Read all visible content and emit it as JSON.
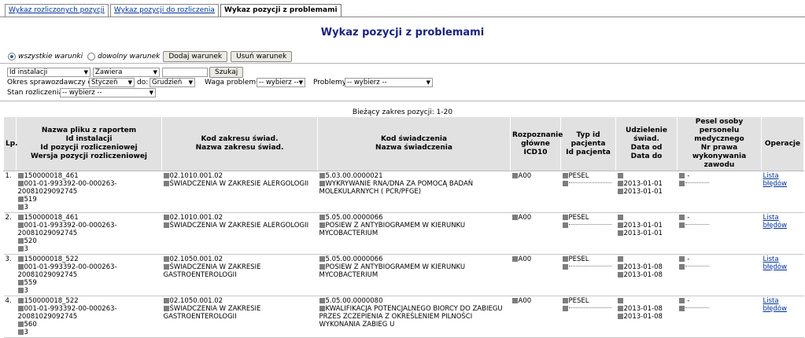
{
  "tabs": [
    "Wykaz rozliczonych pozycji",
    "Wykaz pozycji do rozliczenia",
    "Wykaz pozycji z problemami"
  ],
  "page_title": "Wykaz pozycji z problemami",
  "conditions": {
    "all_label": "wszystkie warunki",
    "any_label": "dowolny warunek",
    "add_button": "Dodaj warunek",
    "remove_button": "Usuń warunek"
  },
  "filter": {
    "field": "Id instalacji",
    "operator": "Zawiera",
    "value": "",
    "search_button": "Szukaj",
    "period_label": "Okres sprawozdawczy od:",
    "from": "Styczeń",
    "to_label": "do:",
    "to": "Grudzień",
    "weight_label": "Waga problemu:",
    "weight": "-- wybierz --",
    "problems_label": "Problemy:",
    "problems": "-- wybierz --",
    "status_label": "Stan rozliczenia:",
    "status": "-- wybierz --"
  },
  "range_text": "Bieżący zakres pozycji: 1-20",
  "headers": {
    "lp": "Lp.",
    "file": [
      "Nazwa pliku z raportem",
      "Id instalacji",
      "Id pozycji rozliczeniowej",
      "Wersja pozycji rozliczeniowej"
    ],
    "range": [
      "Kod zakresu świad.",
      "Nazwa zakresu świad."
    ],
    "service": [
      "Kod świadczenia",
      "Nazwa świadczenia"
    ],
    "icd": [
      "Rozpoznanie",
      "główne ICD10"
    ],
    "patient": [
      "Typ id pacjenta",
      "Id pacjenta"
    ],
    "dates": [
      "Udzielenie świad.",
      "Data od",
      "Data do"
    ],
    "staff": [
      "Pesel osoby",
      "personelu medycznego",
      "Nr prawa",
      "wykonywania zawodu"
    ],
    "ops": "Operacje"
  },
  "rows": [
    {
      "lp": "1.",
      "file": "150000018_461",
      "inst": "001-01-993392-00-000263-20081029092745",
      "pos": "519",
      "ver": "3",
      "rcode": "02.1010.001.02",
      "rname": "ŚWIADCZENIA W ZAKRESIE ALERGOLOGII",
      "scode": "5.03.00.0000021",
      "sname": "WYKRYWANIE RNA/DNA ZA POMOCĄ BADAŃ MOLEKULARNYCH ( PCR/PFGE)",
      "icd": "A00",
      "ptype": "PESEL",
      "dfrom": "2013-01-01",
      "dto": "2013-01-01",
      "staff": "-",
      "op": "Lista błędów"
    },
    {
      "lp": "2.",
      "file": "150000018_461",
      "inst": "001-01-993392-00-000263-20081029092745",
      "pos": "520",
      "ver": "3",
      "rcode": "02.1010.001.02",
      "rname": "ŚWIADCZENIA W ZAKRESIE ALERGOLOGII",
      "scode": "5.05.00.0000066",
      "sname": "POSIEW Z ANTYBIOGRAMEM W KIERUNKU MYCOBACTERIUM",
      "icd": "A00",
      "ptype": "PESEL",
      "dfrom": "2013-01-01",
      "dto": "2013-01-01",
      "staff": "-",
      "op": "Lista błędów"
    },
    {
      "lp": "3.",
      "file": "150000018_522",
      "inst": "001-01-993392-00-000263-20081029092745",
      "pos": "559",
      "ver": "3",
      "rcode": "02.1050.001.02",
      "rname": "ŚWIADCZENIA W ZAKRESIE GASTROENTEROLOGII",
      "scode": "5.05.00.0000066",
      "sname": "POSIEW Z ANTYBIOGRAMEM W KIERUNKU MYCOBACTERIUM",
      "icd": "A00",
      "ptype": "PESEL",
      "dfrom": "2013-01-08",
      "dto": "2013-01-08",
      "staff": "-",
      "op": "Lista błędów"
    },
    {
      "lp": "4.",
      "file": "150000018_522",
      "inst": "001-01-993392-00-000263-20081029092745",
      "pos": "560",
      "ver": "3",
      "rcode": "02.1050.001.02",
      "rname": "ŚWIADCZENIA W ZAKRESIE GASTROENTEROLOGII",
      "scode": "5.05.00.0000080",
      "sname": "KWALIFIKACJA POTENCJALNEGO BIORCY DO ZABIEGU PRZES ZCZEPIENIA Z OKREŚLENIEM PILNOŚCI WYKONANIA ZABIEG U",
      "icd": "A00",
      "ptype": "PESEL",
      "dfrom": "2013-01-08",
      "dto": "2013-01-08",
      "staff": "-",
      "op": "Lista błędów"
    }
  ]
}
